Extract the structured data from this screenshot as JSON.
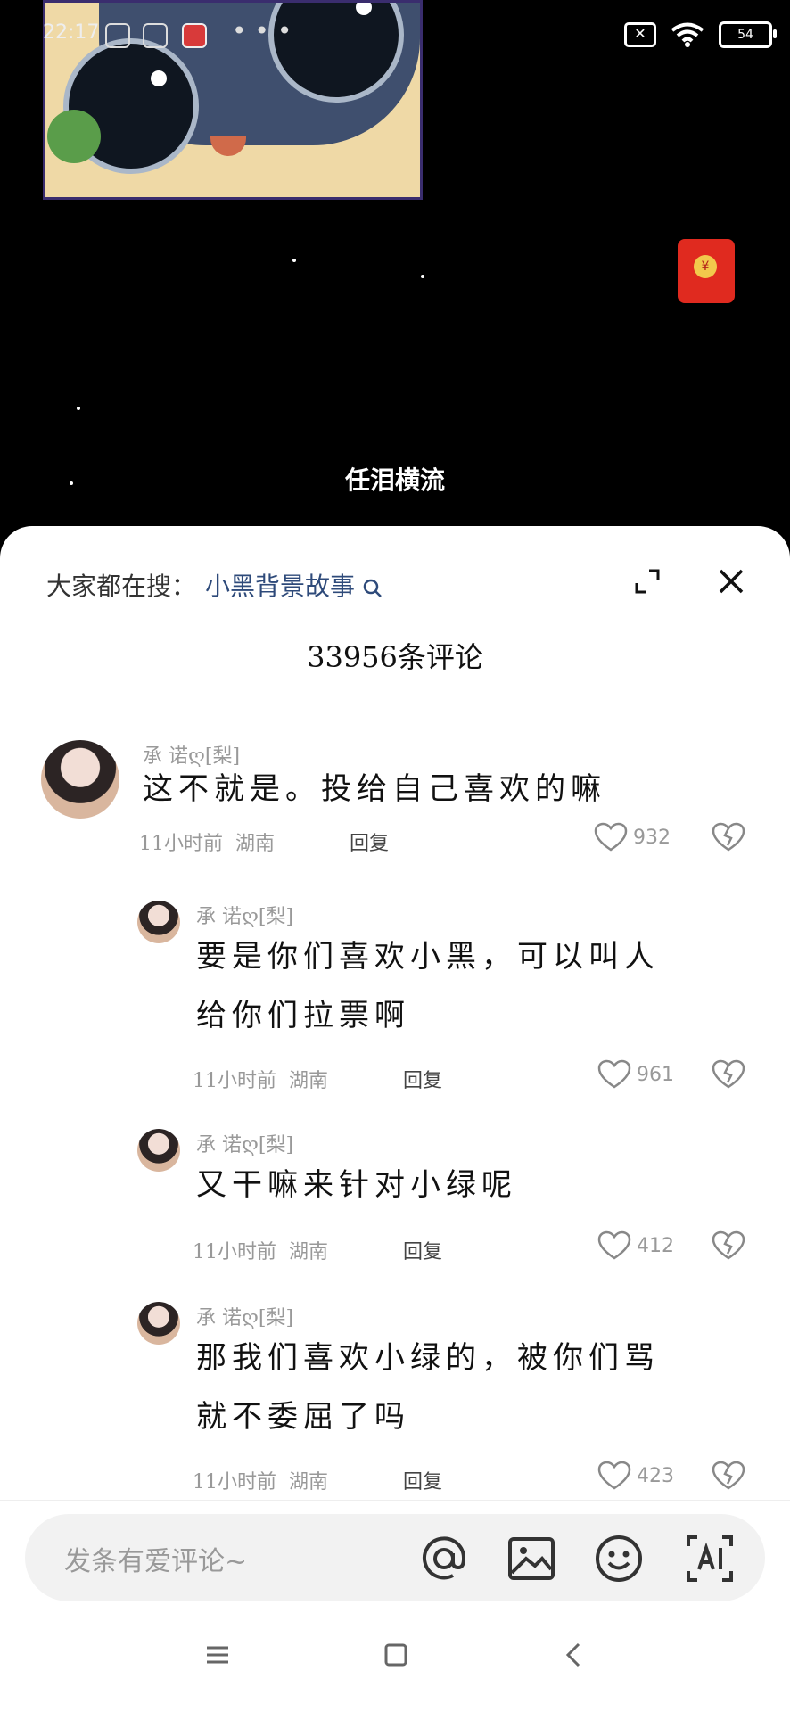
{
  "status_bar": {
    "time": "22:17",
    "battery": "54",
    "more": "• • •"
  },
  "video": {
    "caption": "任泪横流",
    "red_packet_symbol": "¥"
  },
  "sheet": {
    "trending_prefix": "大家都在搜：",
    "trending_keyword": "小黑背景故事",
    "title": "33956条评论"
  },
  "comments": [
    {
      "name": "承 诺ღ[梨]",
      "text": "这不就是。投给自己喜欢的嘛",
      "time": "11小时前",
      "location": "湖南",
      "reply": "回复",
      "likes": "932"
    },
    {
      "name": "承 诺ღ[梨]",
      "text_line1": "要是你们喜欢小黑，可以叫人",
      "text_line2": "给你们拉票啊",
      "time": "11小时前",
      "location": "湖南",
      "reply": "回复",
      "likes": "961"
    },
    {
      "name": "承 诺ღ[梨]",
      "text": "又干嘛来针对小绿呢",
      "time": "11小时前",
      "location": "湖南",
      "reply": "回复",
      "likes": "412"
    },
    {
      "name": "承 诺ღ[梨]",
      "text_line1": "那我们喜欢小绿的，被你们骂",
      "text_line2": "就不委屈了吗",
      "time": "11小时前",
      "location": "湖南",
      "reply": "回复",
      "likes": "423"
    }
  ],
  "input": {
    "placeholder": "发条有爱评论~"
  },
  "icons": {
    "expand": "expand-icon",
    "close": "close-icon",
    "search": "search-icon",
    "at": "at-icon",
    "image": "image-icon",
    "emoji": "emoji-icon",
    "ai": "ai-icon",
    "heart": "heart-icon",
    "dislike": "broken-heart-icon"
  }
}
